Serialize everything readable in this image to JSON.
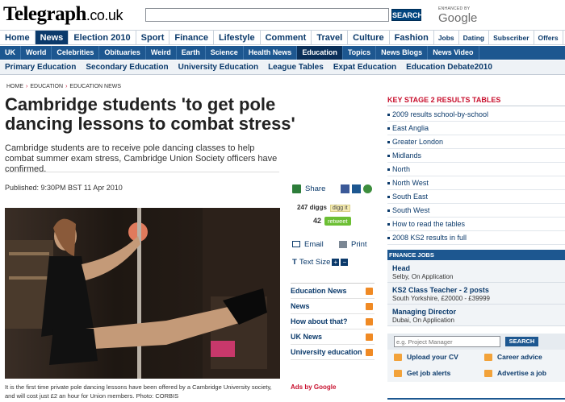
{
  "header": {
    "logo": "Telegraph",
    "logo_suffix": ".co.uk",
    "search_button": "SEARCH",
    "search_value": "",
    "enhanced_by": "ENHANCED BY",
    "google": "Google"
  },
  "nav_primary": [
    "Home",
    "News",
    "Election 2010",
    "Sport",
    "Finance",
    "Lifestyle",
    "Comment",
    "Travel",
    "Culture",
    "Fashion",
    "Jobs",
    "Dating",
    "Subscriber",
    "Offers"
  ],
  "nav_secondary": [
    "UK",
    "World",
    "Celebrities",
    "Obituaries",
    "Weird",
    "Earth",
    "Science",
    "Health News",
    "Education",
    "Topics",
    "News Blogs",
    "News Video"
  ],
  "nav_education": [
    "Primary Education",
    "Secondary Education",
    "University Education",
    "League Tables",
    "Expat Education",
    "Education Debate2010"
  ],
  "breadcrumb": [
    "HOME",
    "EDUCATION",
    "EDUCATION NEWS"
  ],
  "article": {
    "headline": "Cambridge students 'to get pole dancing lessons to combat stress'",
    "standfirst": "Cambridge students are to receive pole dancing classes to help combat summer exam stress, Cambridge Union Society officers have confirmed.",
    "published": "Published: 9:30PM BST 11 Apr 2010",
    "caption": "It is the first time private pole dancing lessons have been offered by a Cambridge University society, and will cost just £2 an hour for Union members.  Photo: CORBIS"
  },
  "tools": {
    "share": "Share",
    "diggs": "247 diggs",
    "digg_it": "digg it",
    "tweets": "42",
    "retweet": "retweet",
    "email": "Email",
    "print": "Print",
    "text_size": "Text Size",
    "plus": "+",
    "minus": "−"
  },
  "related": [
    "Education News",
    "News",
    "How about that?",
    "UK News",
    "University education"
  ],
  "ads_by": "Ads by Google",
  "ks2": {
    "title": "KEY STAGE 2 RESULTS TABLES",
    "items": [
      "2009 results school-by-school",
      "East Anglia",
      "Greater London",
      "Midlands",
      "North",
      "North West",
      "South East",
      "South West",
      "How to read the tables",
      "2008 KS2 results in full"
    ]
  },
  "finance_jobs": {
    "title": "FINANCE JOBS",
    "jobs": [
      {
        "title": "Head",
        "detail": "Selby, On Application"
      },
      {
        "title": "KS2 Class Teacher - 2 posts",
        "detail": "South Yorkshire, £20000 - £39999"
      },
      {
        "title": "Managing Director",
        "detail": "Dubai, On Application"
      }
    ],
    "search_placeholder": "e.g. Project Manager",
    "search_button": "SEARCH",
    "links": [
      "Upload your CV",
      "Career advice",
      "Get job alerts",
      "Advertise a job"
    ]
  },
  "colors": {
    "brand_navy": "#0b3a6b",
    "nav_blue": "#1d5790",
    "accent_red": "#c8102e",
    "retweet_green": "#6cbf34",
    "rss_orange": "#f08a24"
  }
}
